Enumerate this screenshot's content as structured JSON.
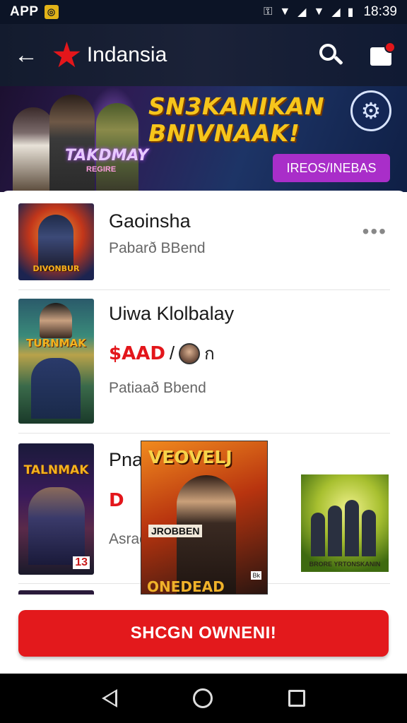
{
  "status_bar": {
    "app_label": "APP",
    "time": "18:39"
  },
  "app_bar": {
    "title": "Indansia"
  },
  "banner": {
    "headline_line1": "SN3KANIKAN",
    "headline_line2": "BNIVNAAK!",
    "logo_text": "TAKDMAY",
    "logo_subtext": "REGIRE",
    "cta_label": "IREOS/INEBAS"
  },
  "items": [
    {
      "title": "Gaoinsha",
      "subtitle": "Pabarð BBend",
      "thumb_caption": "DIVONBUR"
    },
    {
      "title": "Uiwa Klolbalay",
      "price": "$AAD",
      "price_sep": "/",
      "price_glyph": "ก",
      "subtitle": "Patiaað Bbend",
      "thumb_caption": "TURNMAK"
    },
    {
      "title": "Pna",
      "price": "D",
      "subtitle": "Asrad",
      "thumb_caption": "TALNMAK",
      "thumb_badge": "13"
    }
  ],
  "overlay_poster": {
    "title": "VEOVELJ",
    "label": "JROBBEN",
    "footer": "ONEDEAD",
    "tag": "Bk"
  },
  "side_image": {
    "caption": "BRORE YRTONSKANIN"
  },
  "cta": {
    "label": "SHCGN OWNENI!"
  }
}
